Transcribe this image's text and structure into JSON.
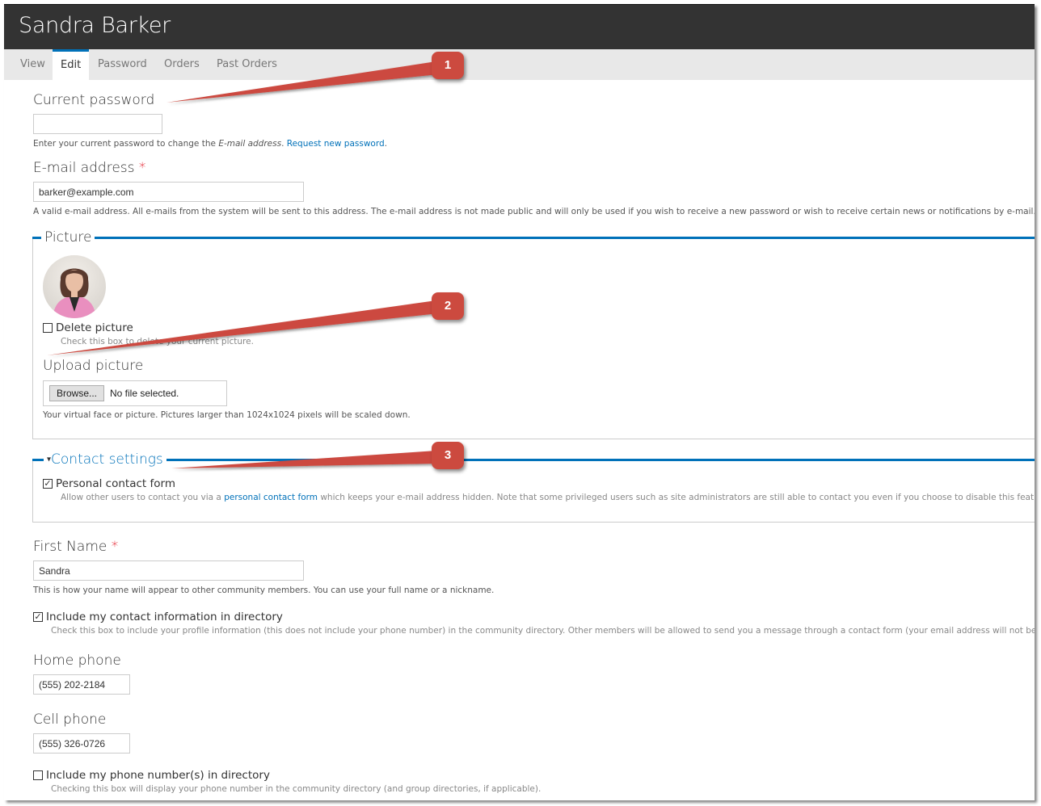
{
  "page": {
    "title": "Sandra Barker"
  },
  "tabs": [
    {
      "label": "View",
      "active": false
    },
    {
      "label": "Edit",
      "active": true
    },
    {
      "label": "Password",
      "active": false
    },
    {
      "label": "Orders",
      "active": false
    },
    {
      "label": "Past Orders",
      "active": false
    }
  ],
  "current_password": {
    "label": "Current password",
    "value": "",
    "description_prefix": "Enter your current password to change the ",
    "description_em": "E-mail address",
    "description_mid": ". ",
    "description_link": "Request new password",
    "description_suffix": "."
  },
  "email": {
    "label": "E-mail address",
    "required_marker": "*",
    "value": "barker@example.com",
    "description": "A valid e-mail address. All e-mails from the system will be sent to this address. The e-mail address is not made public and will only be used if you wish to receive a new password or wish to receive certain news or notifications by e-mail."
  },
  "picture": {
    "legend": "Picture",
    "avatar_alt": "User picture",
    "delete": {
      "label": "Delete picture",
      "checked": false,
      "description": "Check this box to delete your current picture."
    },
    "upload": {
      "label": "Upload picture",
      "browse_label": "Browse...",
      "status": "No file selected.",
      "description": "Your virtual face or picture. Pictures larger than 1024x1024 pixels will be scaled down."
    }
  },
  "contact_settings": {
    "legend": "Contact settings",
    "toggle_glyph": "▾",
    "personal_contact_form": {
      "label": "Personal contact form",
      "checked": true,
      "description_prefix": "Allow other users to contact you via a ",
      "description_link": "personal contact form",
      "description_suffix": " which keeps your e-mail address hidden. Note that some privileged users such as site administrators are still able to contact you even if you choose to disable this feature."
    }
  },
  "first_name": {
    "label": "First Name",
    "required_marker": "*",
    "value": "Sandra",
    "description": "This is how your name will appear to other community members. You can use your full name or a nickname."
  },
  "include_contact": {
    "label": "Include my contact information in directory",
    "checked": true,
    "description": "Check this box to include your profile information (this does not include your phone number) in the community directory. Other members will be allowed to send you a message through a contact form (your email address will not be visible)."
  },
  "home_phone": {
    "label": "Home phone",
    "value": "(555) 202-2184"
  },
  "cell_phone": {
    "label": "Cell phone",
    "value": "(555) 326-0726"
  },
  "include_phone": {
    "label": "Include my phone number(s) in directory",
    "checked": false,
    "description": "Checking this box will display your phone number in the community directory (and group directories, if applicable)."
  },
  "callouts": [
    {
      "number": "1",
      "target": "Current password"
    },
    {
      "number": "2",
      "target": "Upload picture"
    },
    {
      "number": "3",
      "target": "Contact settings"
    }
  ],
  "colors": {
    "header_bg": "#333333",
    "tabs_bg": "#e8e8e8",
    "accent": "#0071b9",
    "required": "#e0000f",
    "callout": "#cc4a3f"
  },
  "glyphs": {
    "check": "✓"
  }
}
